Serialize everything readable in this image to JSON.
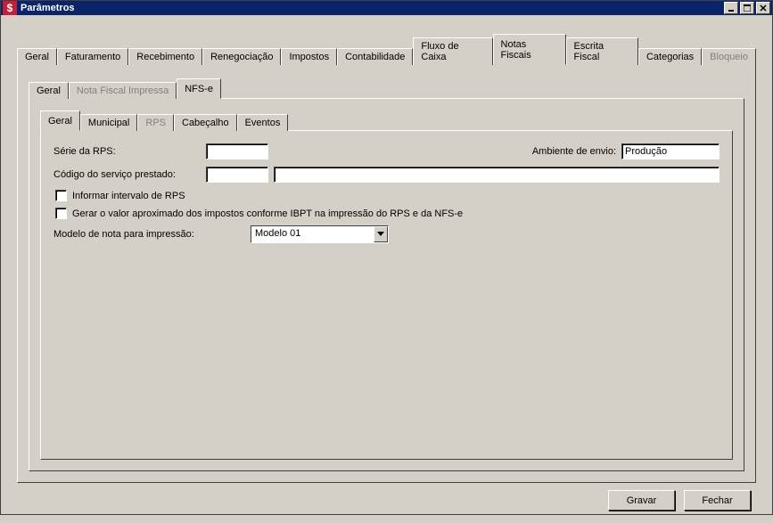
{
  "window": {
    "title": "Parâmetros"
  },
  "tabs1": {
    "items": [
      "Geral",
      "Faturamento",
      "Recebimento",
      "Renegociação",
      "Impostos",
      "Contabilidade",
      "Fluxo de Caixa",
      "Notas Fiscais",
      "Escrita Fiscal",
      "Categorias",
      "Bloqueio"
    ],
    "active": "Notas Fiscais",
    "disabled": [
      "Bloqueio"
    ]
  },
  "tabs2": {
    "items": [
      "Geral",
      "Nota Fiscal Impressa",
      "NFS-e"
    ],
    "active": "NFS-e",
    "disabled": [
      "Nota Fiscal Impressa"
    ]
  },
  "tabs3": {
    "items": [
      "Geral",
      "Municipal",
      "RPS",
      "Cabeçalho",
      "Eventos"
    ],
    "active": "Geral",
    "disabled": [
      "RPS"
    ]
  },
  "form": {
    "serie_rps_label": "Série da RPS:",
    "serie_rps_value": "",
    "ambiente_envio_label": "Ambiente de envio:",
    "ambiente_envio_value": "Produção",
    "codigo_servico_label": "Código do serviço prestado:",
    "codigo_servico_value": "",
    "codigo_servico_desc": "",
    "chk_intervalo_rps": "Informar intervalo de RPS",
    "chk_gerar_ibpt": "Gerar o valor aproximado dos impostos conforme IBPT na impressão do RPS e da NFS-e",
    "modelo_nota_label": "Modelo de nota para impressão:",
    "modelo_nota_value": "Modelo 01"
  },
  "buttons": {
    "gravar": "Gravar",
    "fechar": "Fechar"
  }
}
